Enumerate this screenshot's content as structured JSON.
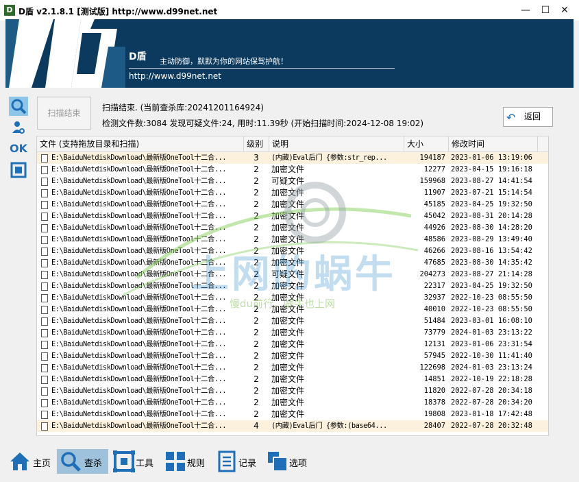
{
  "window": {
    "title": "D盾 v2.1.8.1 [测试版] http://www.d99net.net",
    "icon_label": "D",
    "controls": [
      "—",
      "☐",
      "✕"
    ]
  },
  "banner": {
    "title": "D盾",
    "slogan": "主动防御，默默为你的网站保驾护航！",
    "url": "http://www.d99net.net"
  },
  "side_tools": [
    {
      "name": "search-icon"
    },
    {
      "name": "user-scan-icon"
    },
    {
      "name": "ok-icon",
      "label": "OK"
    },
    {
      "name": "window-icon"
    }
  ],
  "scan": {
    "button_label": "扫描结束",
    "status": "扫描结束. (当前查杀库:20241201164924)",
    "stats": "检测文件数:3084 发现可疑文件:24, 用时:11.39秒 (开始扫描时间:2024-12-08 19:02)",
    "back_label": "返回"
  },
  "table": {
    "columns": [
      "文件 (支持拖放目录和扫描)",
      "级别",
      "说明",
      "大小",
      "修改时间"
    ],
    "rows": [
      {
        "file": "E:\\BaiduNetdiskDownload\\最新版OneTool十二合...",
        "level": "3",
        "desc": "(内藏)Eval后门 {参数:str_rep...",
        "size": "194187",
        "time": "2023-01-06 13:19:06",
        "highlight": true
      },
      {
        "file": "E:\\BaiduNetdiskDownload\\最新版OneTool十二合...",
        "level": "2",
        "desc": "加密文件",
        "size": "12277",
        "time": "2023-04-15 19:16:18"
      },
      {
        "file": "E:\\BaiduNetdiskDownload\\最新版OneTool十二合...",
        "level": "2",
        "desc": "可疑文件",
        "size": "159968",
        "time": "2023-08-27 14:41:54"
      },
      {
        "file": "E:\\BaiduNetdiskDownload\\最新版OneTool十二合...",
        "level": "2",
        "desc": "加密文件",
        "size": "11907",
        "time": "2023-07-21 15:14:54"
      },
      {
        "file": "E:\\BaiduNetdiskDownload\\最新版OneTool十二合...",
        "level": "2",
        "desc": "加密文件",
        "size": "45185",
        "time": "2023-04-25 19:32:50"
      },
      {
        "file": "E:\\BaiduNetdiskDownload\\最新版OneTool十二合...",
        "level": "2",
        "desc": "加密文件",
        "size": "45042",
        "time": "2023-08-31 20:14:28"
      },
      {
        "file": "E:\\BaiduNetdiskDownload\\最新版OneTool十二合...",
        "level": "2",
        "desc": "加密文件",
        "size": "44926",
        "time": "2023-08-30 14:28:20"
      },
      {
        "file": "E:\\BaiduNetdiskDownload\\最新版OneTool十二合...",
        "level": "2",
        "desc": "加密文件",
        "size": "48586",
        "time": "2023-08-29 13:49:40"
      },
      {
        "file": "E:\\BaiduNetdiskDownload\\最新版OneTool十二合...",
        "level": "2",
        "desc": "加密文件",
        "size": "46266",
        "time": "2023-08-16 13:54:42"
      },
      {
        "file": "E:\\BaiduNetdiskDownload\\最新版OneTool十二合...",
        "level": "2",
        "desc": "加密文件",
        "size": "47685",
        "time": "2023-08-30 14:35:42"
      },
      {
        "file": "E:\\BaiduNetdiskDownload\\最新版OneTool十二合...",
        "level": "2",
        "desc": "可疑文件",
        "size": "204273",
        "time": "2023-08-27 21:14:28"
      },
      {
        "file": "E:\\BaiduNetdiskDownload\\最新版OneTool十二合...",
        "level": "2",
        "desc": "加密文件",
        "size": "22317",
        "time": "2023-04-25 19:32:50"
      },
      {
        "file": "E:\\BaiduNetdiskDownload\\最新版OneTool十二合...",
        "level": "2",
        "desc": "加密文件",
        "size": "32937",
        "time": "2022-10-23 08:55:50"
      },
      {
        "file": "E:\\BaiduNetdiskDownload\\最新版OneTool十二合...",
        "level": "2",
        "desc": "加密文件",
        "size": "40010",
        "time": "2022-10-23 08:55:50"
      },
      {
        "file": "E:\\BaiduNetdiskDownload\\最新版OneTool十二合...",
        "level": "2",
        "desc": "加密文件",
        "size": "51484",
        "time": "2023-03-01 16:08:10"
      },
      {
        "file": "E:\\BaiduNetdiskDownload\\最新版OneTool十二合...",
        "level": "2",
        "desc": "加密文件",
        "size": "73779",
        "time": "2024-01-03 23:13:22"
      },
      {
        "file": "E:\\BaiduNetdiskDownload\\最新版OneTool十二合...",
        "level": "2",
        "desc": "加密文件",
        "size": "12131",
        "time": "2023-01-06 23:31:54"
      },
      {
        "file": "E:\\BaiduNetdiskDownload\\最新版OneTool十二合...",
        "level": "2",
        "desc": "加密文件",
        "size": "57945",
        "time": "2022-10-30 11:41:40"
      },
      {
        "file": "E:\\BaiduNetdiskDownload\\最新版OneTool十二合...",
        "level": "2",
        "desc": "加密文件",
        "size": "122698",
        "time": "2024-01-03 23:13:24"
      },
      {
        "file": "E:\\BaiduNetdiskDownload\\最新版OneTool十二合...",
        "level": "2",
        "desc": "加密文件",
        "size": "14851",
        "time": "2022-10-19 22:18:28"
      },
      {
        "file": "E:\\BaiduNetdiskDownload\\最新版OneTool十二合...",
        "level": "2",
        "desc": "加密文件",
        "size": "11820",
        "time": "2022-07-28 20:34:18"
      },
      {
        "file": "E:\\BaiduNetdiskDownload\\最新版OneTool十二合...",
        "level": "2",
        "desc": "加密文件",
        "size": "18378",
        "time": "2022-07-28 20:34:20"
      },
      {
        "file": "E:\\BaiduNetdiskDownload\\最新版OneTool十二合...",
        "level": "2",
        "desc": "加密文件",
        "size": "19808",
        "time": "2023-01-18 17:42:48"
      },
      {
        "file": "E:\\BaiduNetdiskDownload\\最新版OneTool十二合...",
        "level": "4",
        "desc": "(内藏)Eval后门 {参数:(base64...",
        "size": "28407",
        "time": "2022-07-28 20:32:48",
        "highlight": true
      }
    ]
  },
  "watermark": {
    "main": "上网的蜗牛",
    "sub": "慢du前行，蜗牛也上网"
  },
  "nav": [
    {
      "label": "主页",
      "icon": "home-icon"
    },
    {
      "label": "查杀",
      "icon": "search-icon",
      "active": true
    },
    {
      "label": "工具",
      "icon": "tools-icon"
    },
    {
      "label": "规则",
      "icon": "rules-icon"
    },
    {
      "label": "记录",
      "icon": "log-icon"
    },
    {
      "label": "选项",
      "icon": "options-icon"
    }
  ],
  "colors": {
    "banner": "#0c3a5e",
    "accent": "#1e6fb8",
    "highlight_row": "#fbf1dc",
    "nav_active": "#9ec2dc"
  }
}
